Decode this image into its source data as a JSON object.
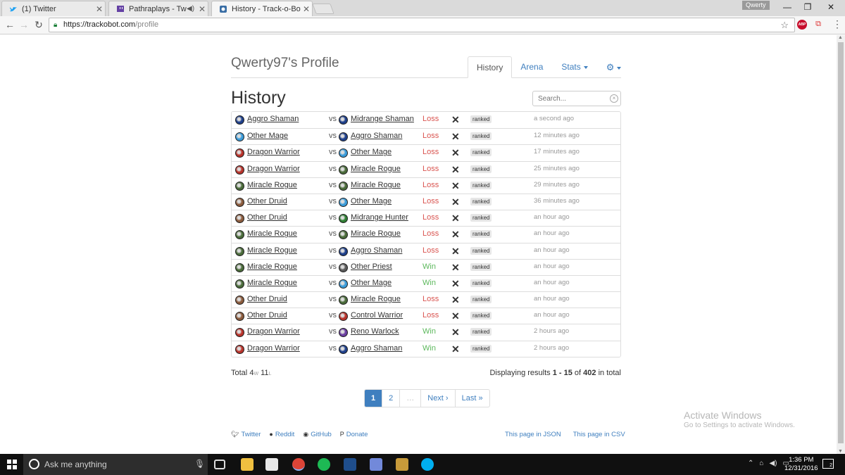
{
  "browser": {
    "tabs": [
      {
        "title": "(1) Twitter",
        "icon": "twitter-icon",
        "color": "#1da1f2"
      },
      {
        "title": "Pathraplays - Twitch",
        "icon": "twitch-icon",
        "color": "#6441a4"
      },
      {
        "title": "History - Track-o-Bot",
        "icon": "trackobot-icon",
        "color": "#3a6ea5"
      }
    ],
    "user_badge": "Qwerty",
    "url_host": "https://trackobot.com",
    "url_path": "/profile"
  },
  "page": {
    "profile_title": "Qwerty97's Profile",
    "nav": {
      "history": "History",
      "arena": "Arena",
      "stats": "Stats"
    },
    "heading": "History",
    "search_placeholder": "Search...",
    "matches": [
      {
        "mine": "Aggro Shaman",
        "mine_class": "shaman",
        "vs": "vs",
        "opp": "Midrange Shaman",
        "opp_class": "shaman",
        "result": "Loss",
        "mode": "ranked",
        "time": "a second ago"
      },
      {
        "mine": "Other Mage",
        "mine_class": "mage",
        "vs": "vs",
        "opp": "Aggro Shaman",
        "opp_class": "shaman",
        "result": "Loss",
        "mode": "ranked",
        "time": "12 minutes ago"
      },
      {
        "mine": "Dragon Warrior",
        "mine_class": "warrior",
        "vs": "vs",
        "opp": "Other Mage",
        "opp_class": "mage",
        "result": "Loss",
        "mode": "ranked",
        "time": "17 minutes ago"
      },
      {
        "mine": "Dragon Warrior",
        "mine_class": "warrior",
        "vs": "vs",
        "opp": "Miracle Rogue",
        "opp_class": "rogue",
        "result": "Loss",
        "mode": "ranked",
        "time": "25 minutes ago"
      },
      {
        "mine": "Miracle Rogue",
        "mine_class": "rogue",
        "vs": "vs",
        "opp": "Miracle Rogue",
        "opp_class": "rogue",
        "result": "Loss",
        "mode": "ranked",
        "time": "29 minutes ago"
      },
      {
        "mine": "Other Druid",
        "mine_class": "druid",
        "vs": "vs",
        "opp": "Other Mage",
        "opp_class": "mage",
        "result": "Loss",
        "mode": "ranked",
        "time": "36 minutes ago"
      },
      {
        "mine": "Other Druid",
        "mine_class": "druid",
        "vs": "vs",
        "opp": "Midrange Hunter",
        "opp_class": "hunter",
        "result": "Loss",
        "mode": "ranked",
        "time": "an hour ago"
      },
      {
        "mine": "Miracle Rogue",
        "mine_class": "rogue",
        "vs": "vs",
        "opp": "Miracle Rogue",
        "opp_class": "rogue",
        "result": "Loss",
        "mode": "ranked",
        "time": "an hour ago"
      },
      {
        "mine": "Miracle Rogue",
        "mine_class": "rogue",
        "vs": "vs",
        "opp": "Aggro Shaman",
        "opp_class": "shaman",
        "result": "Loss",
        "mode": "ranked",
        "time": "an hour ago"
      },
      {
        "mine": "Miracle Rogue",
        "mine_class": "rogue",
        "vs": "vs",
        "opp": "Other Priest",
        "opp_class": "priest",
        "result": "Win",
        "mode": "ranked",
        "time": "an hour ago"
      },
      {
        "mine": "Miracle Rogue",
        "mine_class": "rogue",
        "vs": "vs",
        "opp": "Other Mage",
        "opp_class": "mage",
        "result": "Win",
        "mode": "ranked",
        "time": "an hour ago"
      },
      {
        "mine": "Other Druid",
        "mine_class": "druid",
        "vs": "vs",
        "opp": "Miracle Rogue",
        "opp_class": "rogue",
        "result": "Loss",
        "mode": "ranked",
        "time": "an hour ago"
      },
      {
        "mine": "Other Druid",
        "mine_class": "druid",
        "vs": "vs",
        "opp": "Control Warrior",
        "opp_class": "warrior",
        "result": "Loss",
        "mode": "ranked",
        "time": "an hour ago"
      },
      {
        "mine": "Dragon Warrior",
        "mine_class": "warrior",
        "vs": "vs",
        "opp": "Reno Warlock",
        "opp_class": "warlock",
        "result": "Win",
        "mode": "ranked",
        "time": "2 hours ago"
      },
      {
        "mine": "Dragon Warrior",
        "mine_class": "warrior",
        "vs": "vs",
        "opp": "Aggro Shaman",
        "opp_class": "shaman",
        "result": "Win",
        "mode": "ranked",
        "time": "2 hours ago"
      }
    ],
    "total": {
      "label": "Total",
      "wins": "4",
      "w": "W",
      "losses": "11",
      "l": "L"
    },
    "displaying": {
      "prefix": "Displaying results",
      "range": "1 - 15",
      "of": "of",
      "count": "402",
      "suffix": "in total"
    },
    "pagination": {
      "current": "1",
      "second": "2",
      "ellipsis": "…",
      "next": "Next ›",
      "last": "Last »"
    },
    "footer_links": {
      "twitter": "Twitter",
      "reddit": "Reddit",
      "github": "GitHub",
      "donate": "Donate",
      "json": "This page in JSON",
      "csv": "This page in CSV"
    },
    "watermark": {
      "title": "Activate Windows",
      "subtitle": "Go to Settings to activate Windows."
    }
  },
  "class_colors": {
    "shaman": "#1e3f8a",
    "mage": "#3a9bd9",
    "warrior": "#b8322a",
    "rogue": "#4a6b3a",
    "druid": "#8a5a3c",
    "hunter": "#2e7d32",
    "priest": "#5a5a5a",
    "warlock": "#6a3ea1"
  },
  "taskbar": {
    "search_text": "Ask me anything",
    "time": "1:36 PM",
    "date": "12/31/2016",
    "notifications": "2",
    "apps": [
      {
        "name": "file-explorer-icon",
        "color": "#f0c040"
      },
      {
        "name": "store-icon",
        "color": "#e8e8e8"
      },
      {
        "name": "chrome-icon",
        "color": "#db4437"
      },
      {
        "name": "spotify-icon",
        "color": "#1db954"
      },
      {
        "name": "hearthstone-deck-tracker-icon",
        "color": "#1f4e8c"
      },
      {
        "name": "discord-icon",
        "color": "#7289da"
      },
      {
        "name": "hearthstone-icon",
        "color": "#c79a3a"
      },
      {
        "name": "skype-icon",
        "color": "#00aff0"
      }
    ]
  }
}
